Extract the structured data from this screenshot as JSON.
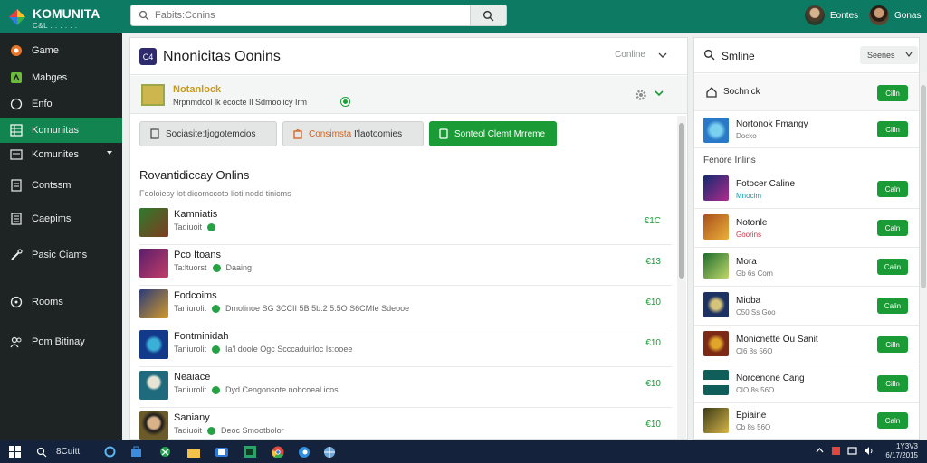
{
  "app": {
    "title": "KOMUNITA",
    "subtitle": "C&L . . . . . ."
  },
  "colors": {
    "brand": "#0d7a63",
    "accent": "#1a9b36",
    "sidebar": "#1e2423",
    "taskbar": "#14233b"
  },
  "search": {
    "placeholder": "Fabits:Ccnins"
  },
  "users": [
    {
      "name": "Eontes",
      "icon": "avatar-icon"
    },
    {
      "name": "Gonas",
      "icon": "avatar-icon"
    }
  ],
  "sidebar": {
    "items": [
      {
        "label": "Game",
        "icon": "controller-icon"
      },
      {
        "label": "Mabges",
        "icon": "badge-icon"
      },
      {
        "label": "Enfo",
        "icon": "info-icon"
      },
      {
        "label": "Komunitas",
        "icon": "grid-icon",
        "active": true
      },
      {
        "label": "Komunites",
        "icon": "list-icon",
        "expandable": true
      },
      {
        "label": "Contssm",
        "icon": "document-icon"
      },
      {
        "label": "Caepims",
        "icon": "list-icon"
      },
      {
        "label": "Pasic Ciams",
        "icon": "wrench-icon"
      },
      {
        "label": "Rooms",
        "icon": "circle-icon"
      },
      {
        "label": "Pom Bitinay",
        "icon": "people-icon"
      }
    ]
  },
  "main": {
    "logo": "C4",
    "title": "Nnonicitas Oonins",
    "status": "Conline",
    "group": {
      "name": "Notanlock",
      "desc": "Nrpnmdcol lk ecocte Il Sdmoolicy Irm"
    },
    "buttons": {
      "a": "Sociasite:Ijogotemcios",
      "b_highlight": "Consimsta",
      "b_rest": "I'laotoomies",
      "c": "Sonteol Clemt Mrreme"
    },
    "section_title": "Rovantidiccay Onlins",
    "section_sub": "Fooloiesy lot dicomccoto lioti nodd tinicms",
    "games": [
      {
        "name": "Kamniatis",
        "meta_a": "Tadiuoit",
        "meta_b": "",
        "price": "€1C",
        "colors": [
          "#2f7a2e",
          "#7f3c1f"
        ]
      },
      {
        "name": "Pco Itoans",
        "meta_a": "Ta:ltuorst",
        "meta_b": "Daaing",
        "price": "€13",
        "colors": [
          "#5a1e6b",
          "#c23d6a"
        ]
      },
      {
        "name": "Fodcoims",
        "meta_a": "Taniurolit",
        "meta_b": "Dmolinoe SG 3CCII 5B 5b:2 5.5O S6CMIe Sdeooe",
        "price": "€10",
        "colors": [
          "#2a3b7a",
          "#d39a2a"
        ]
      },
      {
        "name": "Fontminidah",
        "meta_a": "Taniurolit",
        "meta_b": "Ia'l doole Ogc Scccaduirloc Is:ooee",
        "price": "€10",
        "colors": [
          "#133a8a",
          "#3ab0d8"
        ]
      },
      {
        "name": "Neaiace",
        "meta_a": "Taniurolit",
        "meta_b": "Dyd Cengonsote nobcoeal icos",
        "price": "€10",
        "colors": [
          "#1f6a7c",
          "#e7e4d6"
        ]
      },
      {
        "name": "Saniany",
        "meta_a": "Tadiuoit",
        "meta_b": "Deoc Smootbolor",
        "price": "€10",
        "colors": [
          "#6b5a2a",
          "#1b1b1b"
        ]
      }
    ]
  },
  "right": {
    "title": "Smline",
    "select": "Seenes",
    "top_item": {
      "name": "Sochnick",
      "btn": "Cilln"
    },
    "first": {
      "name": "Nortonok Fmangy",
      "sub": "Docko",
      "btn": "Cilln",
      "colors": [
        "#2a79c8",
        "#7ad0ef"
      ]
    },
    "section": "Fenore Inlins",
    "items": [
      {
        "name": "Fotocer Caline",
        "sub": "Mnocim",
        "tag": "cyan",
        "btn": "Caln",
        "colors": [
          "#122a6e",
          "#b02b8e"
        ]
      },
      {
        "name": "Notonle",
        "sub": "Goorins",
        "tag": "red",
        "btn": "Caln",
        "colors": [
          "#a8501b",
          "#ecb03a"
        ]
      },
      {
        "name": "Mora",
        "sub": "Gb 6s Corn",
        "tag": "",
        "btn": "Calin",
        "colors": [
          "#1f6d2e",
          "#c0d86a"
        ]
      },
      {
        "name": "Mioba",
        "sub": "C50 Ss Goo",
        "tag": "",
        "btn": "Calin",
        "colors": [
          "#1d3263",
          "#d6c47a"
        ]
      },
      {
        "name": "Monicnette Ou Sanit",
        "sub": "CI6 8s 56O",
        "tag": "",
        "btn": "Cilln",
        "colors": [
          "#7c2a16",
          "#e0a52a"
        ]
      },
      {
        "name": "Norcenone Cang",
        "sub": "CIO 8s 56O",
        "tag": "",
        "btn": "Cilln",
        "colors": [
          "#0f5e5a",
          "#ffffff"
        ]
      },
      {
        "name": "Epiaine",
        "sub": "Cb 8s 56O",
        "tag": "",
        "btn": "Caln",
        "colors": [
          "#3b3a16",
          "#d7b64a"
        ]
      }
    ]
  },
  "taskbar": {
    "search_label": "8Cuitt",
    "time": "1Y3V3",
    "date": "6/17/2015",
    "apps": [
      "windows-icon",
      "search-icon",
      "cortana-icon",
      "store-icon",
      "xbox-icon",
      "folder-icon",
      "mail-icon",
      "photos-icon",
      "chrome-icon",
      "edge-icon",
      "globe-icon"
    ]
  }
}
